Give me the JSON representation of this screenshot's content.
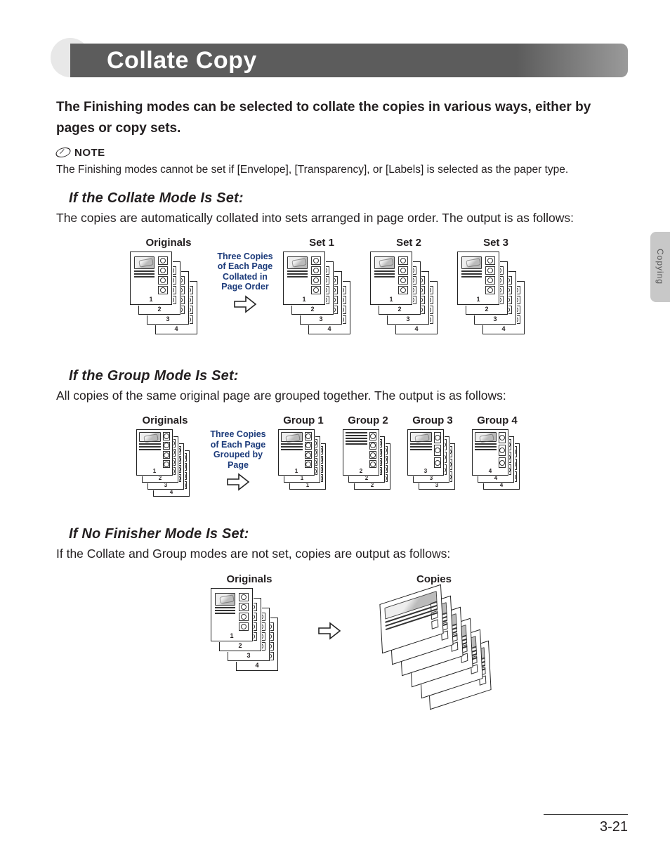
{
  "side_tab": {
    "label": "Copying"
  },
  "header": {
    "title": "Collate Copy"
  },
  "intro": "The Finishing modes can be selected to collate the copies in various ways, either by pages or copy sets.",
  "note": {
    "label": "NOTE",
    "text": "The Finishing modes cannot be set if [Envelope], [Transparency], or [Labels] is selected as the paper type."
  },
  "sections": {
    "collate": {
      "heading": "If the Collate Mode Is Set:",
      "text": "The copies are automatically collated into sets arranged in page order. The output is as follows:",
      "labels": {
        "originals": "Originals",
        "arrow1": "Three Copies",
        "arrow2": "of Each Page",
        "arrow3": "Collated in",
        "arrow4": "Page Order",
        "set1": "Set 1",
        "set2": "Set 2",
        "set3": "Set 3"
      },
      "page_numbers": [
        "1",
        "2",
        "3",
        "4"
      ]
    },
    "group": {
      "heading": "If the Group Mode Is Set:",
      "text": "All copies of the same original page are grouped together. The output is as follows:",
      "labels": {
        "originals": "Originals",
        "arrow1": "Three Copies",
        "arrow2": "of Each Page",
        "arrow3": "Grouped by",
        "arrow4": "Page",
        "g1": "Group 1",
        "g2": "Group 2",
        "g3": "Group 3",
        "g4": "Group 4"
      },
      "originals_nums": [
        "1",
        "2",
        "3",
        "4"
      ],
      "group_nums": {
        "g1": [
          "1",
          "1",
          "1"
        ],
        "g2": [
          "2",
          "2",
          "2"
        ],
        "g3": [
          "3",
          "3",
          "3"
        ],
        "g4": [
          "4",
          "4",
          "4"
        ]
      }
    },
    "nofinisher": {
      "heading": "If No Finisher Mode Is Set:",
      "text": "If the Collate and Group modes are not set, copies are output as follows:",
      "labels": {
        "originals": "Originals",
        "copies": "Copies"
      },
      "page_numbers": [
        "1",
        "2",
        "3",
        "4"
      ]
    }
  },
  "footer": {
    "page": "3-21"
  }
}
